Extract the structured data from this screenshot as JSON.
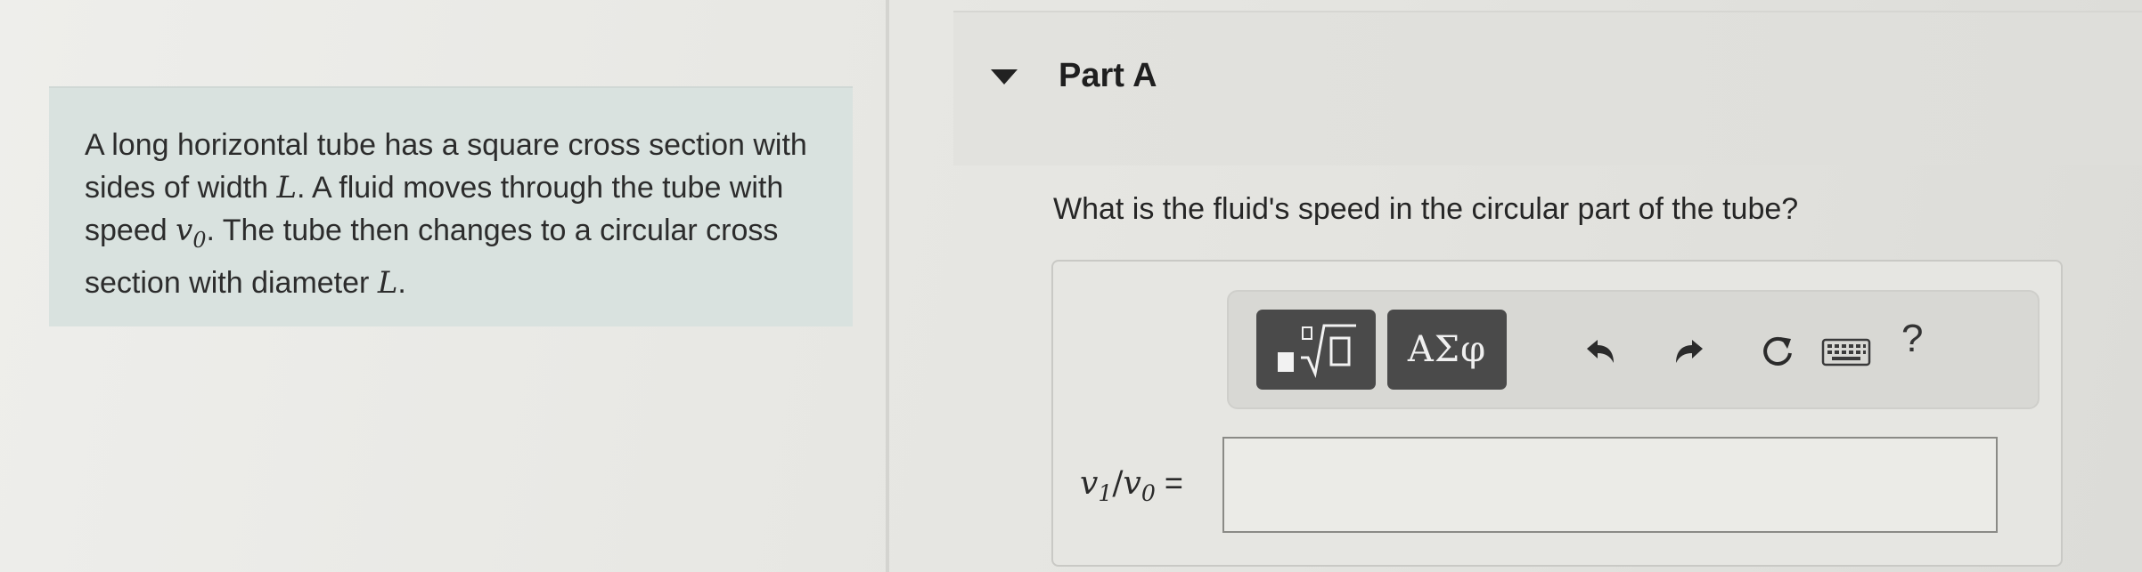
{
  "problem": {
    "text_parts": [
      "A long horizontal tube has a square cross section with sides of width ",
      "L",
      ". A fluid moves through the tube with speed ",
      "v",
      "0",
      ". The tube then changes to a circular cross section with diameter ",
      "L",
      "."
    ]
  },
  "part": {
    "title": "Part A",
    "question": "What is the fluid's speed in the circular part of the tube?"
  },
  "toolbar": {
    "templates_icon": "templates-sqrt-icon",
    "symbols_label": "ΑΣφ",
    "undo_icon": "undo-icon",
    "redo_icon": "redo-icon",
    "reset_icon": "reset-icon",
    "keyboard_icon": "keyboard-icon",
    "help_label": "?"
  },
  "answer": {
    "label_v1": "v",
    "label_v1_sub": "1",
    "label_slash": "/",
    "label_v0": "v",
    "label_v0_sub": "0",
    "label_eq": "=",
    "value": "",
    "placeholder": ""
  }
}
